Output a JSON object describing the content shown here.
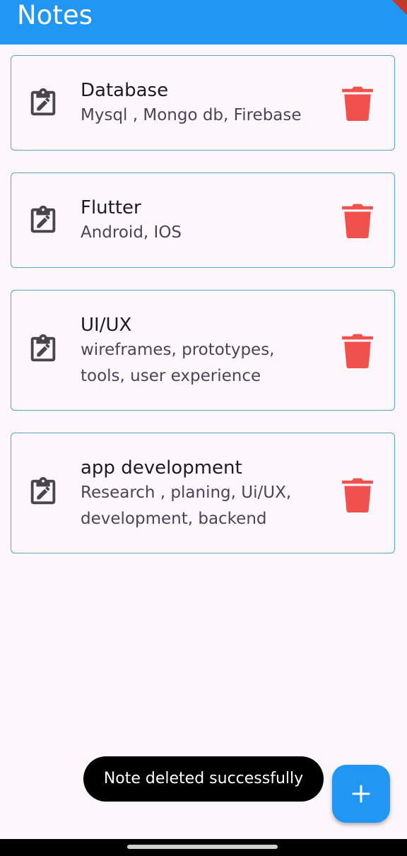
{
  "appbar": {
    "title": "Notes",
    "color": "#2196f3"
  },
  "notes": [
    {
      "icon": "edit-note-icon",
      "title": "Database",
      "body_lines": [
        "Mysql , Mongo db, Firebase"
      ]
    },
    {
      "icon": "edit-note-icon",
      "title": "Flutter",
      "body_lines": [
        "Android, IOS"
      ]
    },
    {
      "icon": "edit-note-icon",
      "title": "UI/UX",
      "body_lines": [
        "wireframes, prototypes,",
        "tools, user experience"
      ]
    },
    {
      "icon": "edit-note-icon",
      "title": "app development",
      "body_lines": [
        "Research , planing, Ui/UX,",
        "development, backend"
      ]
    }
  ],
  "toast": {
    "message": "Note deleted successfully"
  },
  "fab": {
    "icon": "plus-icon"
  },
  "colors": {
    "delete": "#f0514d",
    "card_border": "#5aa3cd",
    "background": "#fdf7fc"
  }
}
